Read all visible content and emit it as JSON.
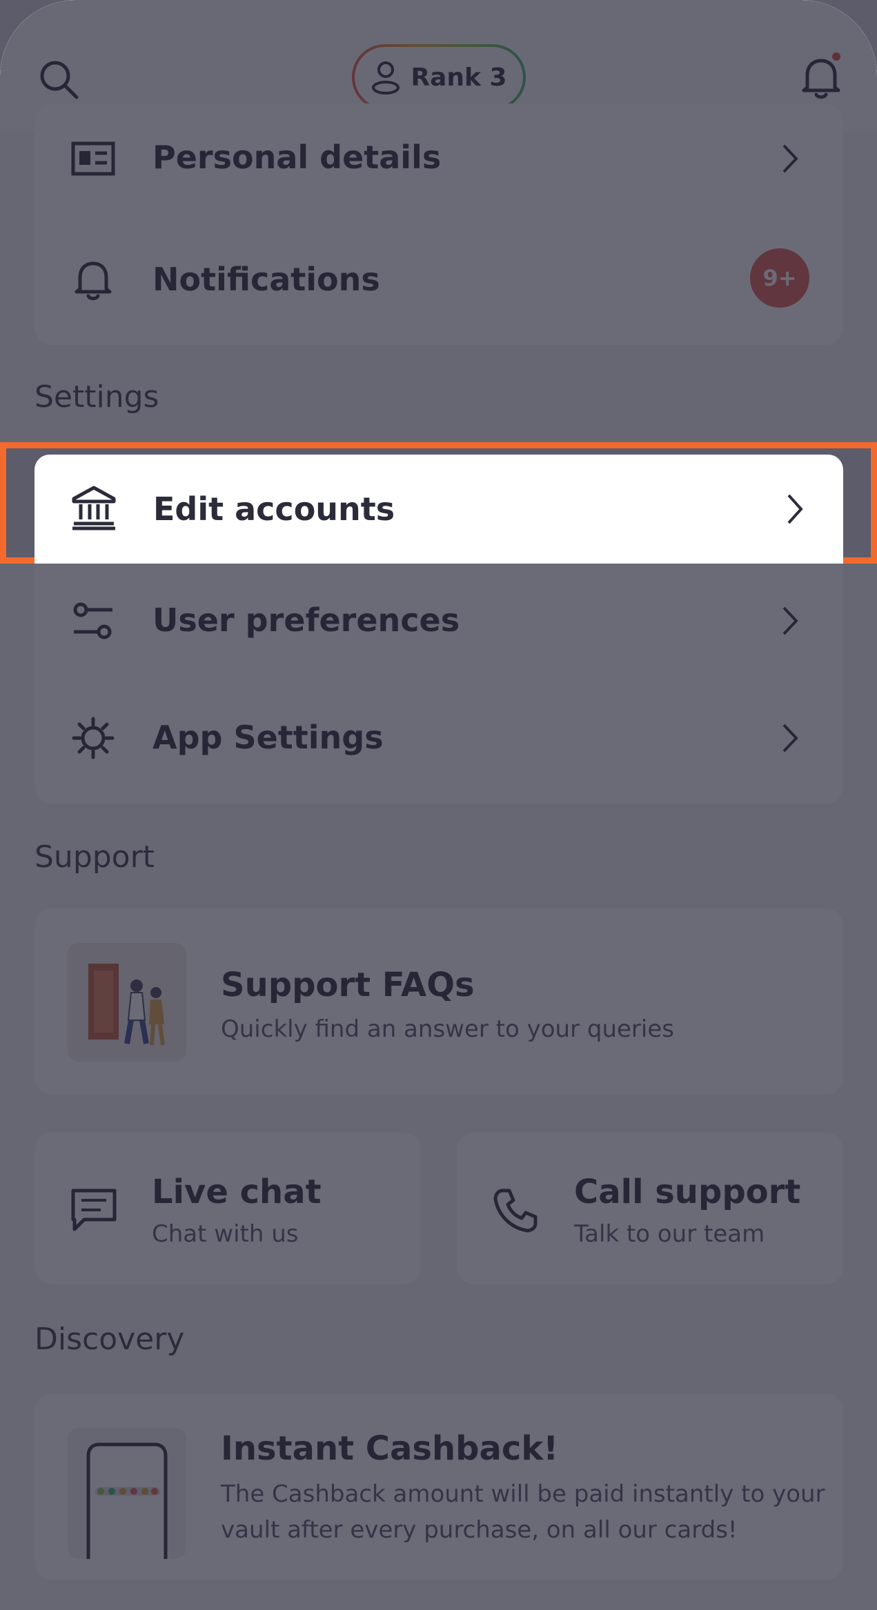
{
  "header": {
    "rank_label": "Rank 3",
    "search_icon": "search-icon",
    "bell_icon": "bell-icon",
    "notification_dot_color": "#e0493b"
  },
  "account": {
    "items": [
      {
        "label": "Personal details",
        "icon": "id-card-icon"
      },
      {
        "label": "Notifications",
        "icon": "bell-icon",
        "badge": "9+"
      }
    ]
  },
  "settings": {
    "title": "Settings",
    "items": [
      {
        "label": "Edit accounts",
        "icon": "bank-icon"
      },
      {
        "label": "User preferences",
        "icon": "sliders-icon"
      },
      {
        "label": "App Settings",
        "icon": "gear-icon"
      }
    ]
  },
  "support": {
    "title": "Support",
    "faq": {
      "title": "Support FAQs",
      "subtitle": "Quickly find an answer to your queries"
    },
    "live_chat": {
      "title": "Live chat",
      "subtitle": "Chat with us"
    },
    "call_support": {
      "title": "Call support",
      "subtitle": "Talk to our team"
    }
  },
  "discovery": {
    "title": "Discovery",
    "promo": {
      "title": "Instant Cashback!",
      "body": "The Cashback amount will be paid instantly to your vault after every purchase, on all our cards!"
    }
  },
  "colors": {
    "highlight_border": "#f26a2e",
    "badge_bg": "#e05a4e"
  }
}
